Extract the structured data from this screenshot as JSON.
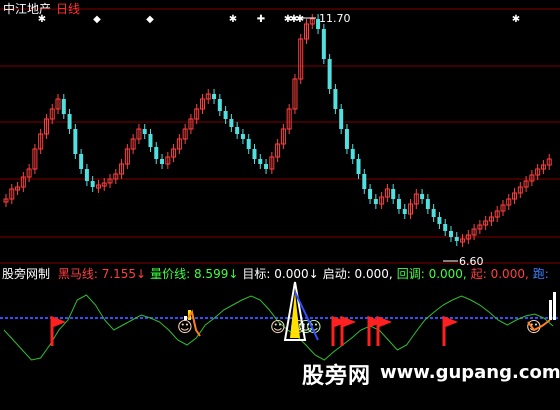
{
  "header": {
    "title": "中江地产",
    "period": "日线"
  },
  "price_labels": {
    "high": "11.70",
    "low": "6.60"
  },
  "indicator": {
    "name": "股旁网制",
    "items": [
      {
        "label": "黑马线:",
        "value": "7.155",
        "arrow": "↓",
        "color": "#ff4040"
      },
      {
        "label": "量价线:",
        "value": "8.599",
        "arrow": "↓",
        "color": "#40ff40"
      },
      {
        "label": "目标:",
        "value": "0.000",
        "arrow": "↓",
        "color": "#ffffff"
      },
      {
        "label": "启动:",
        "value": "0.000,",
        "arrow": "",
        "color": "#ffffff"
      },
      {
        "label": "回调:",
        "value": "0.000,",
        "arrow": "",
        "color": "#40ff40"
      },
      {
        "label": "起:",
        "value": "0.000,",
        "arrow": "",
        "color": "#ff4040"
      },
      {
        "label": "跑:",
        "value": "",
        "arrow": "",
        "color": "#4080ff"
      }
    ]
  },
  "watermark": {
    "brand": "股旁网",
    "url": "www.gupang.com"
  },
  "colors": {
    "up": "#ff4040",
    "down": "#50e0e0",
    "grid": "#800000",
    "baseline": "#3050ff"
  }
}
